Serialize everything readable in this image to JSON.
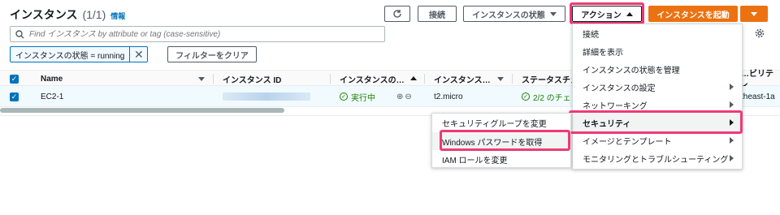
{
  "header": {
    "title": "インスタンス",
    "count": "(1/1)",
    "info": "情報"
  },
  "toolbar": {
    "refresh_icon": "refresh-icon",
    "connect_label": "接続",
    "instance_state_label": "インスタンスの状態",
    "actions_label": "アクション",
    "launch_label": "インスタンスを起動",
    "launch_color": "#ec7211"
  },
  "search": {
    "placeholder": "Find インスタンス by attribute or tag (case-sensitive)"
  },
  "filter": {
    "token_label": "インスタンスの状態 = running",
    "clear_label": "フィルターをクリア"
  },
  "table": {
    "headers": [
      "Name",
      "インスタンス ID",
      "インスタンスの…",
      "インスタンス…",
      "ステータスチェ",
      "…ビリティ…"
    ],
    "row": {
      "name": "EC2-1",
      "instance_id": "",
      "state": "実行中",
      "type": "t2.micro",
      "status_check": "2/2 のチェ",
      "az": "theast-1a"
    }
  },
  "actions_menu": {
    "items": [
      "接続",
      "詳細を表示",
      "インスタンスの状態を管理",
      "インスタンスの設定",
      "ネットワーキング",
      "セキュリティ",
      "イメージとテンプレート",
      "モニタリングとトラブルシューティング"
    ]
  },
  "security_submenu": {
    "items": [
      "セキュリティグループを変更",
      "Windows パスワードを取得",
      "IAM ロールを変更"
    ]
  },
  "colors": {
    "highlight": "#ee3a75",
    "link": "#0073bb",
    "running": "#1d8102"
  }
}
